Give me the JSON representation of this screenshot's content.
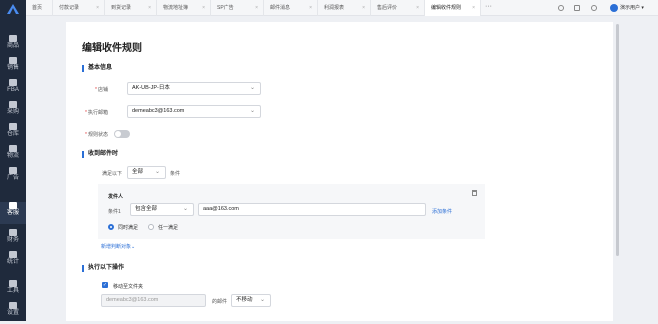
{
  "sidebar": {
    "items": [
      {
        "label": "商品"
      },
      {
        "label": "销售"
      },
      {
        "label": "FBA"
      },
      {
        "label": "采购"
      },
      {
        "label": "仓库"
      },
      {
        "label": "物流"
      },
      {
        "label": "广告"
      },
      {
        "label": "客服"
      },
      {
        "label": "财务"
      },
      {
        "label": "统计"
      },
      {
        "label": "工具"
      },
      {
        "label": "设置"
      }
    ],
    "active": "客服"
  },
  "tabs": [
    {
      "label": "首页"
    },
    {
      "label": "付款记录"
    },
    {
      "label": "到货记录"
    },
    {
      "label": "物流地址簿"
    },
    {
      "label": "SP广告"
    },
    {
      "label": "邮件消息"
    },
    {
      "label": "利润报表"
    },
    {
      "label": "售后评价"
    },
    {
      "label": "编辑收件规则"
    }
  ],
  "tab_close": "×",
  "more_tabs": "···",
  "user": {
    "name": "演示用户",
    "caret": "▾"
  },
  "page_title": "编辑收件规则",
  "basic": {
    "section_title": "基本信息",
    "shop_label": "店铺",
    "shop_value": "AK-UB-JP-日本",
    "email_label": "执行邮箱",
    "email_value": "demeabc3@163.com",
    "status_label": "规则状态",
    "required_mark": "*"
  },
  "receive": {
    "section_title": "收到邮件时",
    "satisfy_prefix": "满足以下",
    "satisfy_value": "全部",
    "satisfy_suffix": "条件",
    "sender_title": "发件人",
    "condition_label": "条件1",
    "condition_op": "包含全部",
    "condition_value": "aaa@163.com",
    "add_condition": "添加条件",
    "radio_all": "同时满足",
    "radio_any": "任一满足",
    "add_condition_object": "新增判断对象"
  },
  "actions": {
    "section_title": "执行以下操作",
    "move_folder_label": "移动至文件夹",
    "folder_placeholder": "demeabc3@163.com",
    "of_mail": "的邮件",
    "move_value": "不移动"
  },
  "colors": {
    "accent": "#2b6fd6",
    "sidebar": "#1f2a3c"
  }
}
